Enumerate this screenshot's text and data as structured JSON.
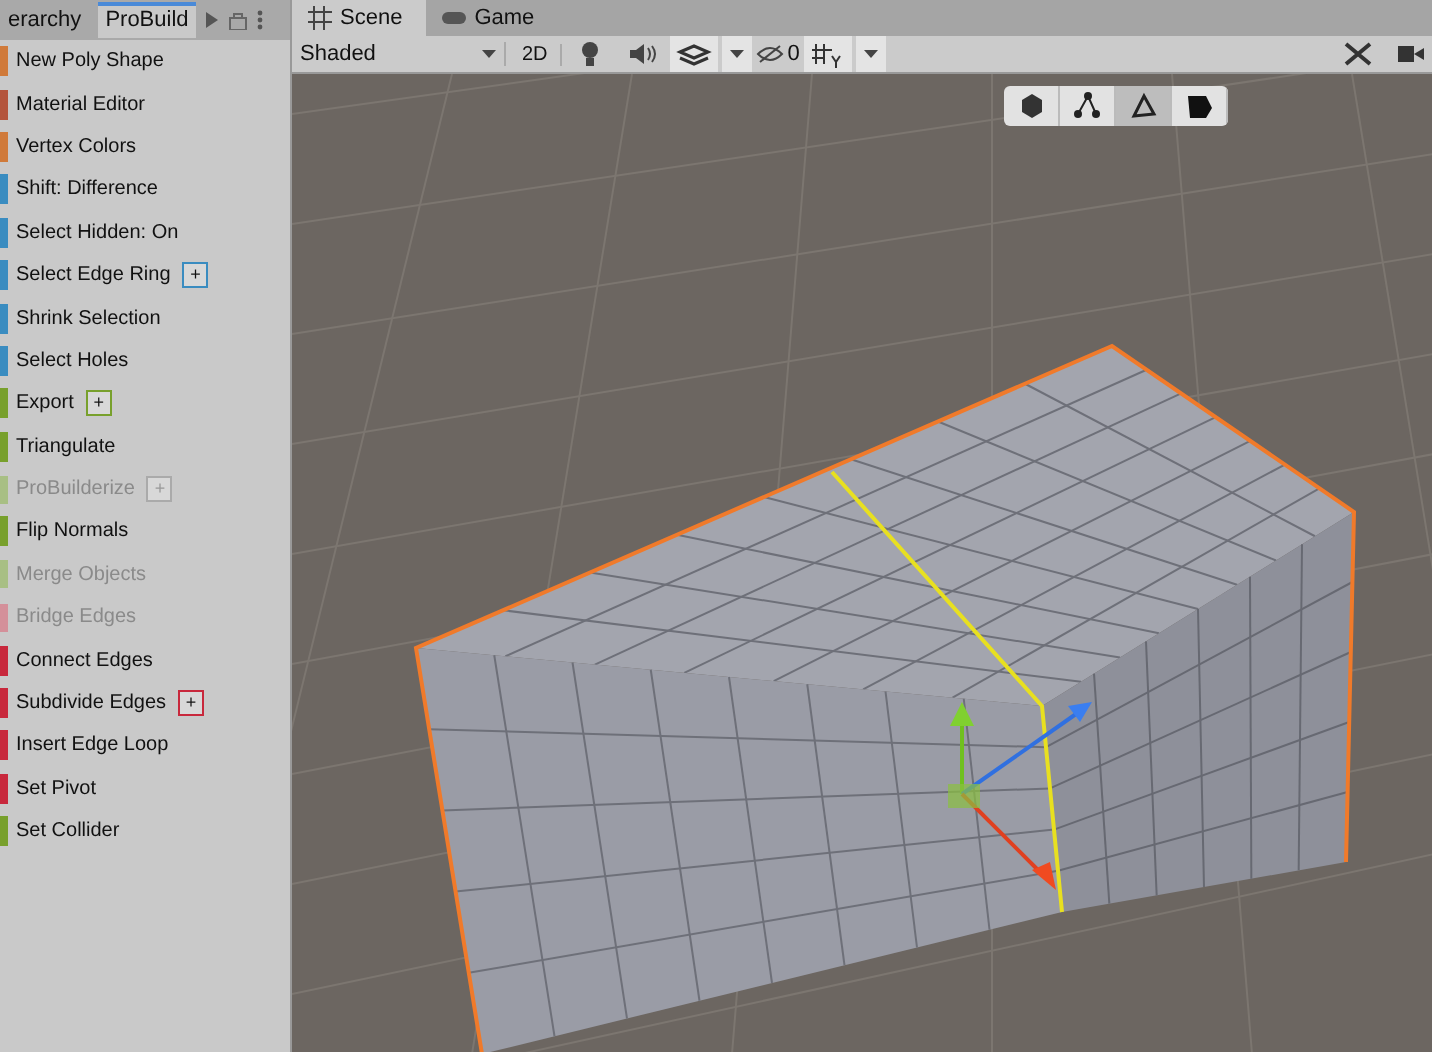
{
  "panel_tabs": [
    {
      "label": "erarchy",
      "selected": false
    },
    {
      "label": "ProBuild",
      "selected": true
    }
  ],
  "tools": [
    {
      "label": "New Poly Shape",
      "color": "#d07a3a",
      "disabled": false
    },
    {
      "label": "Material Editor",
      "color": "#b4543c",
      "disabled": false
    },
    {
      "label": "Vertex Colors",
      "color": "#d07a3a",
      "disabled": false
    },
    {
      "label": "Shift: Difference",
      "color": "#3a8cc0",
      "disabled": false
    },
    {
      "label": "Select Hidden: On",
      "color": "#3a8cc0",
      "disabled": false
    },
    {
      "label": "Select Edge Ring",
      "color": "#3a8cc0",
      "disabled": false,
      "option": "+"
    },
    {
      "label": "Shrink Selection",
      "color": "#3a8cc0",
      "disabled": false
    },
    {
      "label": "Select Holes",
      "color": "#3a8cc0",
      "disabled": false
    },
    {
      "label": "Export",
      "color": "#78a02c",
      "disabled": false,
      "option": "+"
    },
    {
      "label": "Triangulate",
      "color": "#78a02c",
      "disabled": false
    },
    {
      "label": "ProBuilderize",
      "color": "#a8bf84",
      "disabled": true,
      "option": "+"
    },
    {
      "label": "Flip Normals",
      "color": "#78a02c",
      "disabled": false
    },
    {
      "label": "Merge Objects",
      "color": "#a8bf84",
      "disabled": true
    },
    {
      "label": "Bridge Edges",
      "color": "#d4909a",
      "disabled": true
    },
    {
      "label": "Connect Edges",
      "color": "#c8283c",
      "disabled": false
    },
    {
      "label": "Subdivide Edges",
      "color": "#c8283c",
      "disabled": false,
      "option": "+"
    },
    {
      "label": "Insert Edge Loop",
      "color": "#c8283c",
      "disabled": false
    },
    {
      "label": "Set Pivot",
      "color": "#c8283c",
      "disabled": false
    },
    {
      "label": "Set Collider",
      "color": "#78a02c",
      "disabled": false
    }
  ],
  "scene_tabs": [
    {
      "label": "Scene",
      "kind": "scene",
      "selected": true
    },
    {
      "label": "Game",
      "kind": "game",
      "selected": false
    }
  ],
  "toolbar": {
    "shading": "Shaded",
    "mode_2d": "2D",
    "hidden_count": "0"
  },
  "edit_modes": [
    {
      "kind": "object",
      "selected": false
    },
    {
      "kind": "vertex",
      "selected": false
    },
    {
      "kind": "edge",
      "selected": true
    },
    {
      "kind": "face",
      "selected": false
    }
  ]
}
